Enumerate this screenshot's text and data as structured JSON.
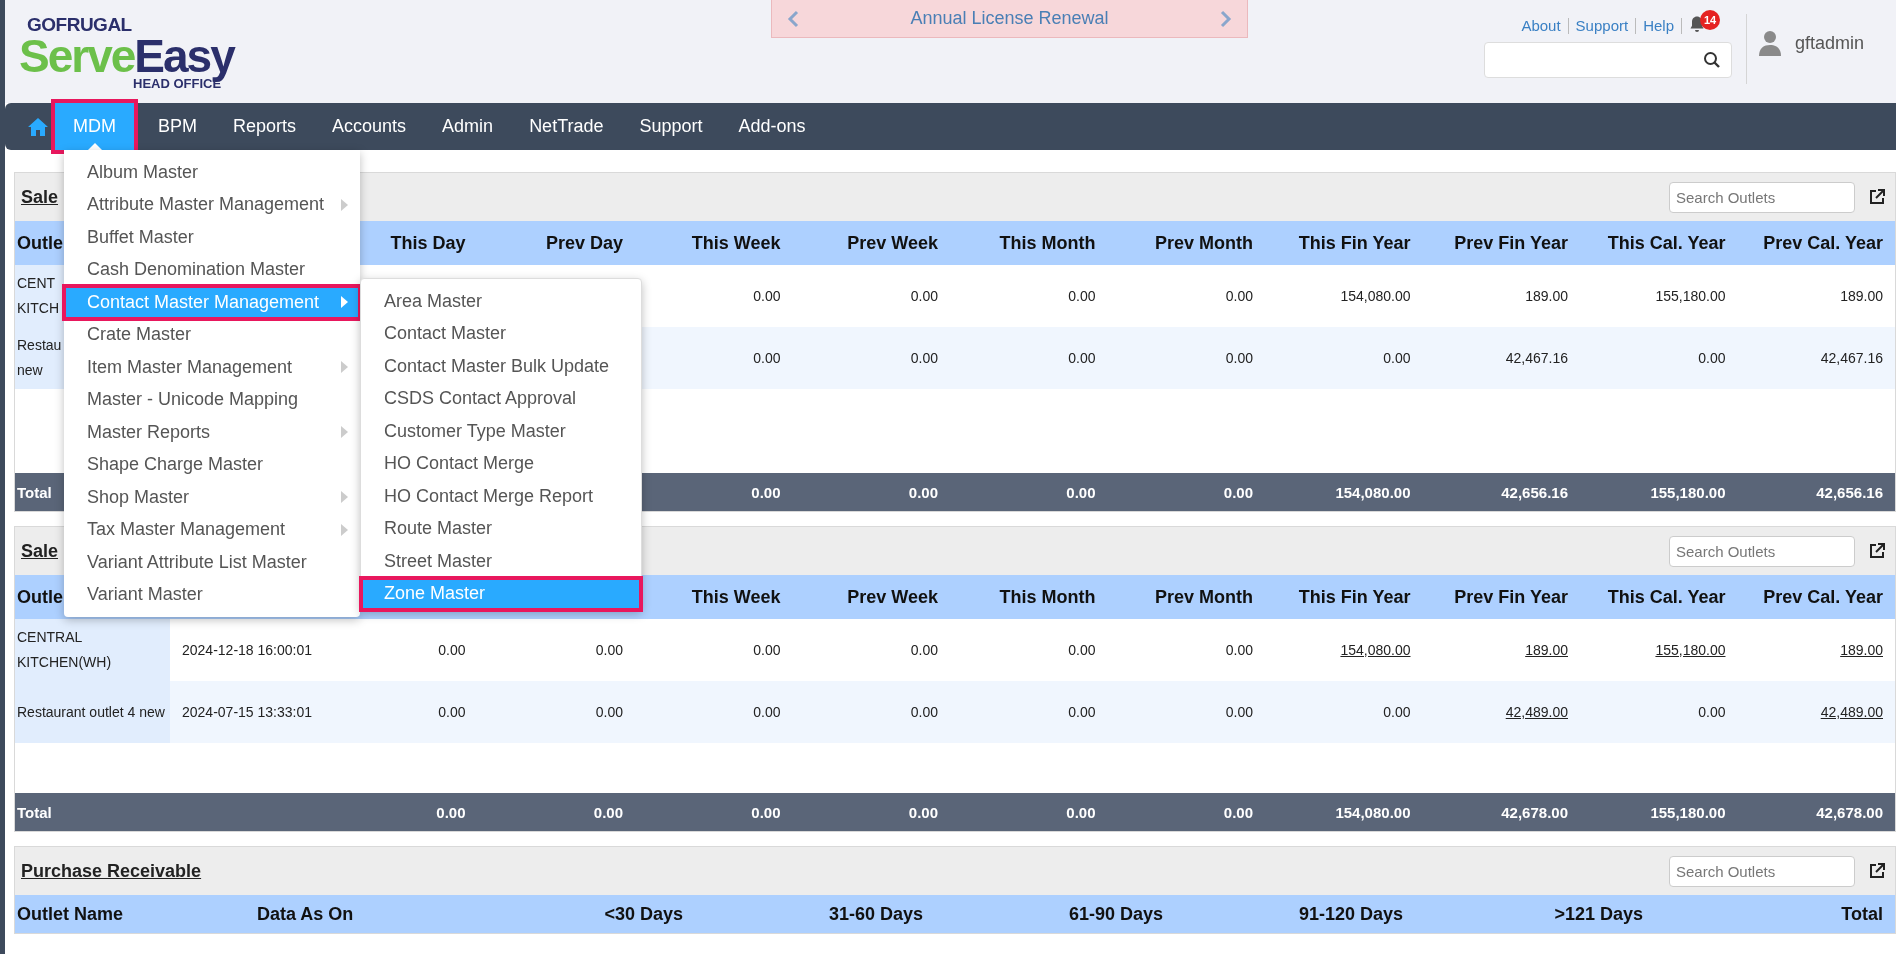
{
  "header": {
    "logo": {
      "brand": "GOFRUGAL",
      "product_a": "Serve",
      "product_b": "Easy",
      "edition": "HEAD OFFICE"
    },
    "banner": {
      "text": "Annual License Renewal"
    },
    "links": [
      "About",
      "Support",
      "Help"
    ],
    "notifications": {
      "count": "14"
    },
    "user": {
      "name": "gftadmin"
    }
  },
  "nav": {
    "items": [
      {
        "label": "MDM",
        "selected": true
      },
      {
        "label": "BPM",
        "selected": false
      },
      {
        "label": "Reports",
        "selected": false
      },
      {
        "label": "Accounts",
        "selected": false
      },
      {
        "label": "Admin",
        "selected": false
      },
      {
        "label": "NetTrade",
        "selected": false
      },
      {
        "label": "Support",
        "selected": false
      },
      {
        "label": "Add-ons",
        "selected": false
      }
    ]
  },
  "menu": {
    "items": [
      {
        "label": "Album Master",
        "submenu": false,
        "selected": false
      },
      {
        "label": "Attribute Master Management",
        "submenu": true,
        "selected": false
      },
      {
        "label": "Buffet Master",
        "submenu": false,
        "selected": false
      },
      {
        "label": "Cash Denomination Master",
        "submenu": false,
        "selected": false
      },
      {
        "label": "Contact Master Management",
        "submenu": true,
        "selected": true
      },
      {
        "label": "Crate Master",
        "submenu": false,
        "selected": false
      },
      {
        "label": "Item Master Management",
        "submenu": true,
        "selected": false
      },
      {
        "label": "Master - Unicode Mapping",
        "submenu": false,
        "selected": false
      },
      {
        "label": "Master Reports",
        "submenu": true,
        "selected": false
      },
      {
        "label": "Shape Charge Master",
        "submenu": false,
        "selected": false
      },
      {
        "label": "Shop Master",
        "submenu": true,
        "selected": false
      },
      {
        "label": "Tax Master Management",
        "submenu": true,
        "selected": false
      },
      {
        "label": "Variant Attribute List Master",
        "submenu": false,
        "selected": false
      },
      {
        "label": "Variant Master",
        "submenu": false,
        "selected": false
      }
    ],
    "submenu": [
      {
        "label": "Area Master",
        "selected": false
      },
      {
        "label": "Contact Master",
        "selected": false
      },
      {
        "label": "Contact Master Bulk Update",
        "selected": false
      },
      {
        "label": "CSDS Contact Approval",
        "selected": false
      },
      {
        "label": "Customer Type Master",
        "selected": false
      },
      {
        "label": "HO Contact Merge",
        "selected": false
      },
      {
        "label": "HO Contact Merge Report",
        "selected": false
      },
      {
        "label": "Route Master",
        "selected": false
      },
      {
        "label": "Street Master",
        "selected": false
      },
      {
        "label": "Zone Master",
        "selected": true
      }
    ]
  },
  "sections": [
    {
      "title": "Sale",
      "search_placeholder": "Search Outlets",
      "kind": "sales",
      "header": {
        "outlet": "Outle",
        "values": [
          "This Day",
          "Prev Day",
          "This Week",
          "Prev Week",
          "This Month",
          "Prev Month",
          "This Fin Year",
          "Prev Fin Year",
          "This Cal. Year",
          "Prev Cal. Year"
        ]
      },
      "rows": [
        {
          "outlet": "CENT\nKITCH",
          "values": [
            "0.00",
            "0.00",
            "0.00",
            "0.00",
            "154,080.00",
            "189.00",
            "155,180.00",
            "189.00"
          ]
        },
        {
          "outlet": "Restau\nnew",
          "values": [
            "0.00",
            "0.00",
            "0.00",
            "0.00",
            "0.00",
            "42,467.16",
            "0.00",
            "42,467.16"
          ]
        }
      ],
      "total": {
        "label": "Total",
        "values": [
          "0.00",
          "0.00",
          "0.00",
          "0.00",
          "154,080.00",
          "42,656.16",
          "155,180.00",
          "42,656.16"
        ]
      }
    },
    {
      "title": "Sale",
      "search_placeholder": "Search Outlets",
      "kind": "sales",
      "header": {
        "outlet": "Outle",
        "values": [
          "This Week",
          "Prev Week",
          "This Month",
          "Prev Month",
          "This Fin Year",
          "Prev Fin Year",
          "This Cal. Year",
          "Prev Cal. Year"
        ]
      },
      "rows": [
        {
          "outlet": "CENTRAL KITCHEN(WH)",
          "data_as_on": "2024-12-18 16:00:01",
          "values": [
            "0.00",
            "0.00",
            "0.00",
            "0.00",
            "0.00",
            "0.00",
            {
              "text": "154,080.00",
              "link": true
            },
            {
              "text": "189.00",
              "link": true
            },
            {
              "text": "155,180.00",
              "link": true
            },
            {
              "text": "189.00",
              "link": true
            }
          ]
        },
        {
          "outlet": "Restaurant outlet 4 new",
          "data_as_on": "2024-07-15 13:33:01",
          "values": [
            "0.00",
            "0.00",
            "0.00",
            "0.00",
            "0.00",
            "0.00",
            "0.00",
            {
              "text": "42,489.00",
              "link": true
            },
            "0.00",
            {
              "text": "42,489.00",
              "link": true
            }
          ]
        }
      ],
      "total": {
        "label": "Total",
        "values": [
          "0.00",
          "0.00",
          "0.00",
          "0.00",
          "0.00",
          "0.00",
          "154,080.00",
          "42,678.00",
          "155,180.00",
          "42,678.00"
        ]
      }
    },
    {
      "title": "Purchase Receivable",
      "search_placeholder": "Search Outlets",
      "kind": "receivable",
      "header": {
        "outlet": "Outlet Name",
        "data_as_on": "Data As On",
        "values": [
          "<30 Days",
          "31-60 Days",
          "61-90 Days",
          "91-120 Days",
          ">121 Days",
          "Total"
        ]
      }
    }
  ]
}
